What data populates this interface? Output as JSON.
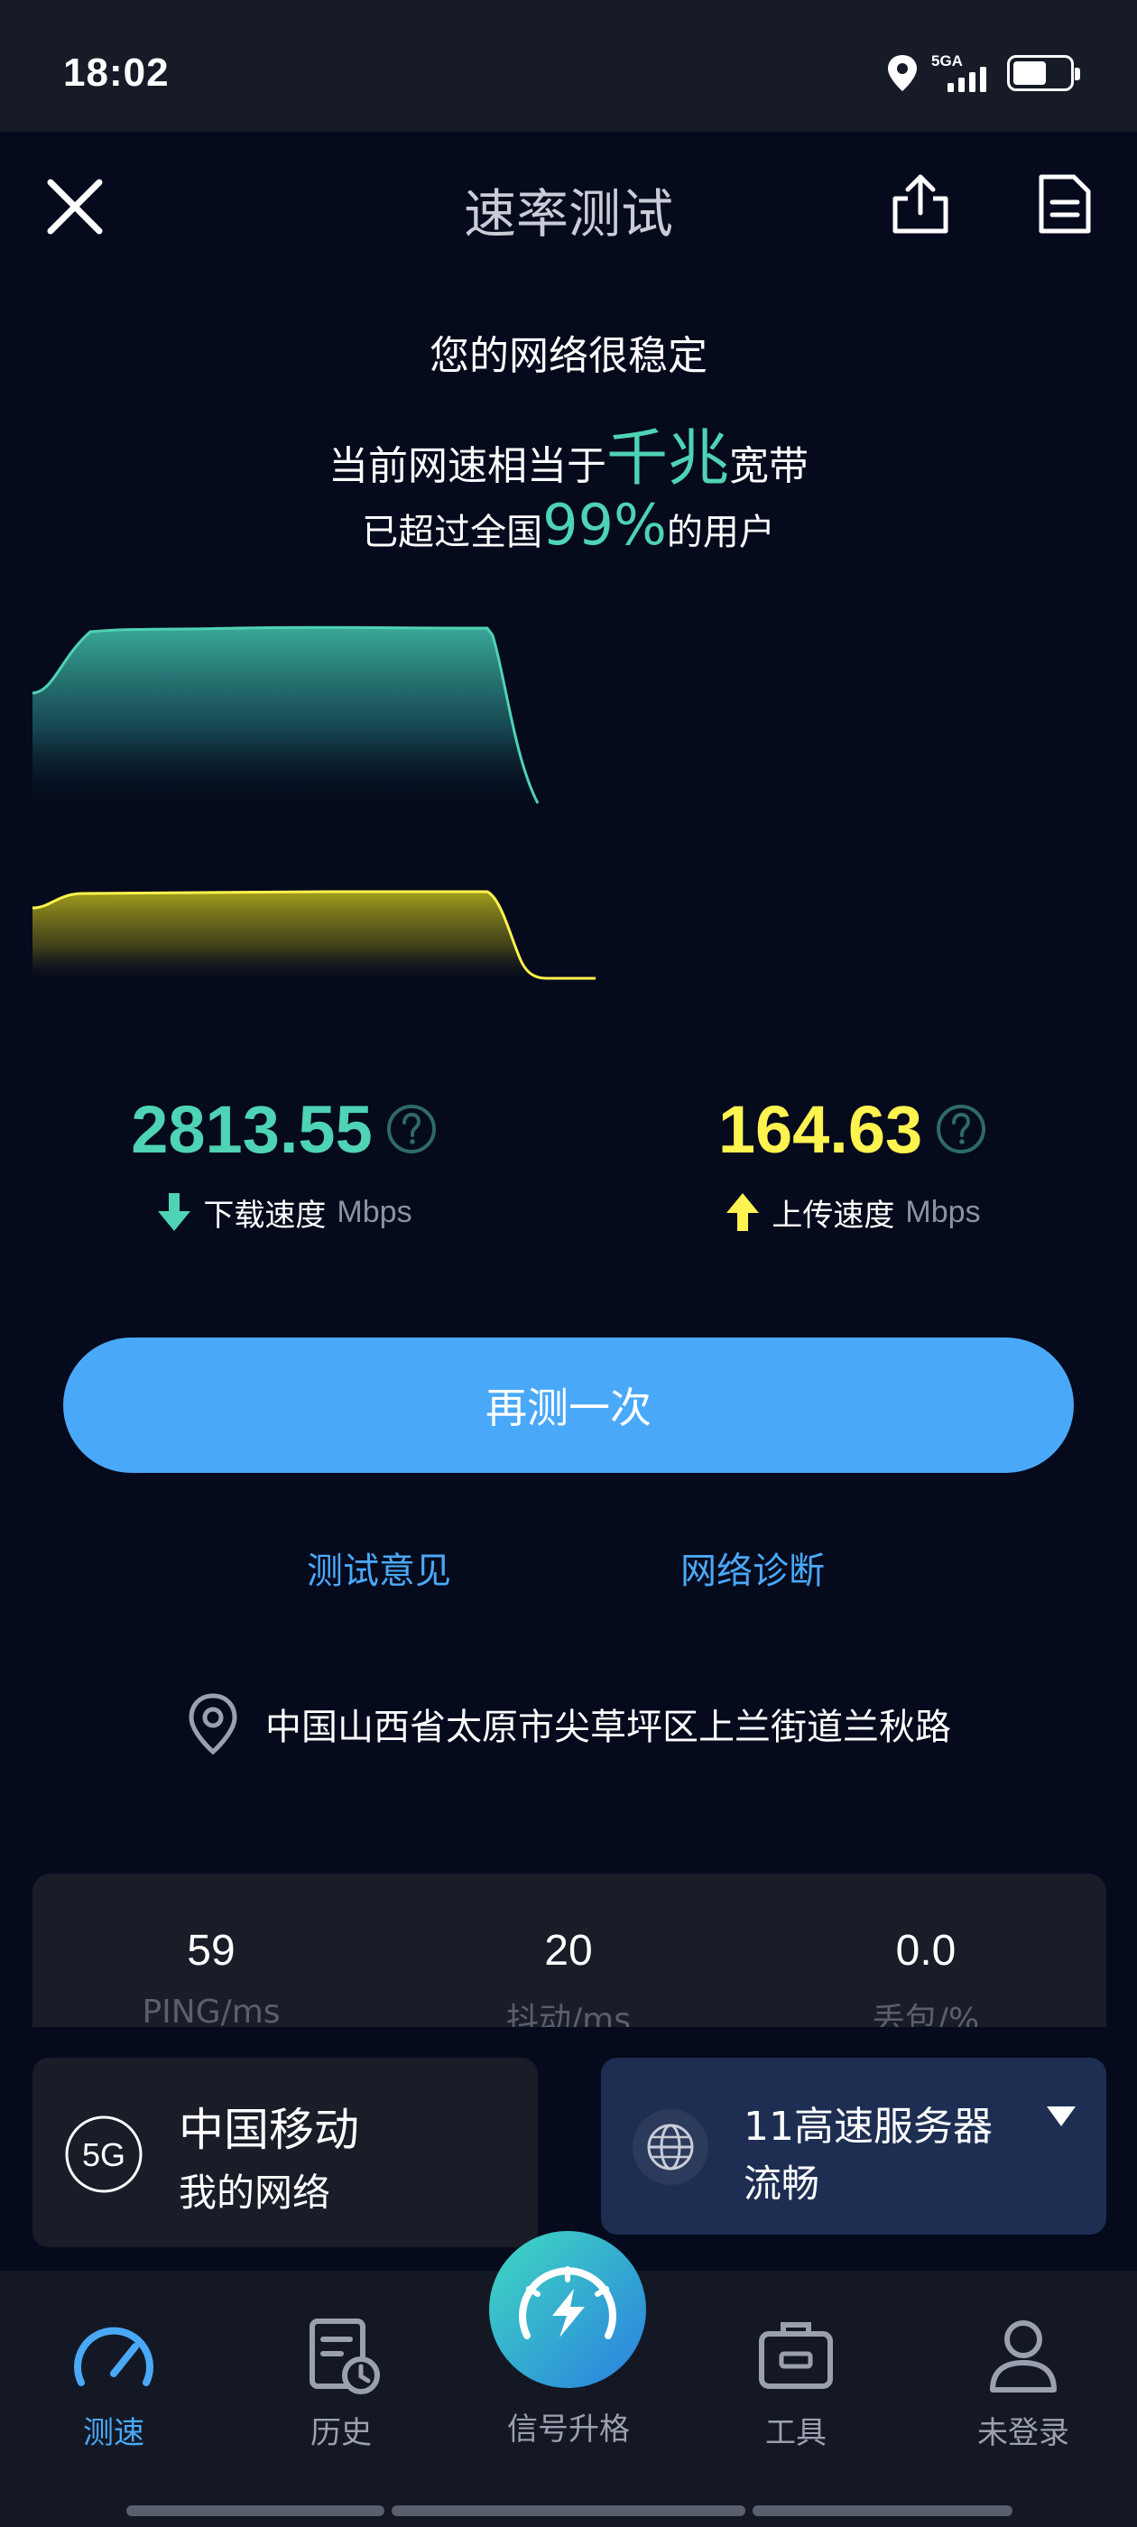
{
  "status_bar": {
    "time": "18:02",
    "network": "5GA"
  },
  "header": {
    "title": "速率测试"
  },
  "summary": {
    "line1": "您的网络很稳定",
    "line2_prefix": "当前网速相当于",
    "line2_highlight": "千兆",
    "line2_suffix": "宽带",
    "line3_prefix": "已超过全国",
    "line3_highlight": "99%",
    "line3_suffix": "的用户"
  },
  "results": {
    "download": {
      "value": "2813.55",
      "label": "下载速度",
      "unit": "Mbps",
      "color": "#4ED3B4"
    },
    "upload": {
      "value": "164.63",
      "label": "上传速度",
      "unit": "Mbps",
      "color": "#FFF34F"
    }
  },
  "actions": {
    "retest_label": "再测一次",
    "feedback_label": "测试意见",
    "diagnose_label": "网络诊断"
  },
  "location": {
    "text": "中国山西省太原市尖草坪区上兰街道兰秋路"
  },
  "stats": [
    {
      "value": "59",
      "label": "PING/ms"
    },
    {
      "value": "20",
      "label": "抖动/ms"
    },
    {
      "value": "0.0",
      "label": "丢包/%"
    }
  ],
  "operator": {
    "badge": "5G",
    "name": "中国移动",
    "sub": "我的网络"
  },
  "server": {
    "name": "11高速服务器",
    "status": "流畅"
  },
  "nav": {
    "items": [
      {
        "label": "测速",
        "icon": "speedometer-icon",
        "active": true
      },
      {
        "label": "历史",
        "icon": "history-icon"
      },
      {
        "label": "信号升格",
        "icon": "signal-boost-icon"
      },
      {
        "label": "工具",
        "icon": "toolbox-icon"
      },
      {
        "label": "未登录",
        "icon": "user-icon"
      }
    ]
  },
  "colors": {
    "accent": "#4AA8F8",
    "download": "#4ED3B4",
    "upload": "#FFF34F",
    "background": "#050A1C"
  }
}
